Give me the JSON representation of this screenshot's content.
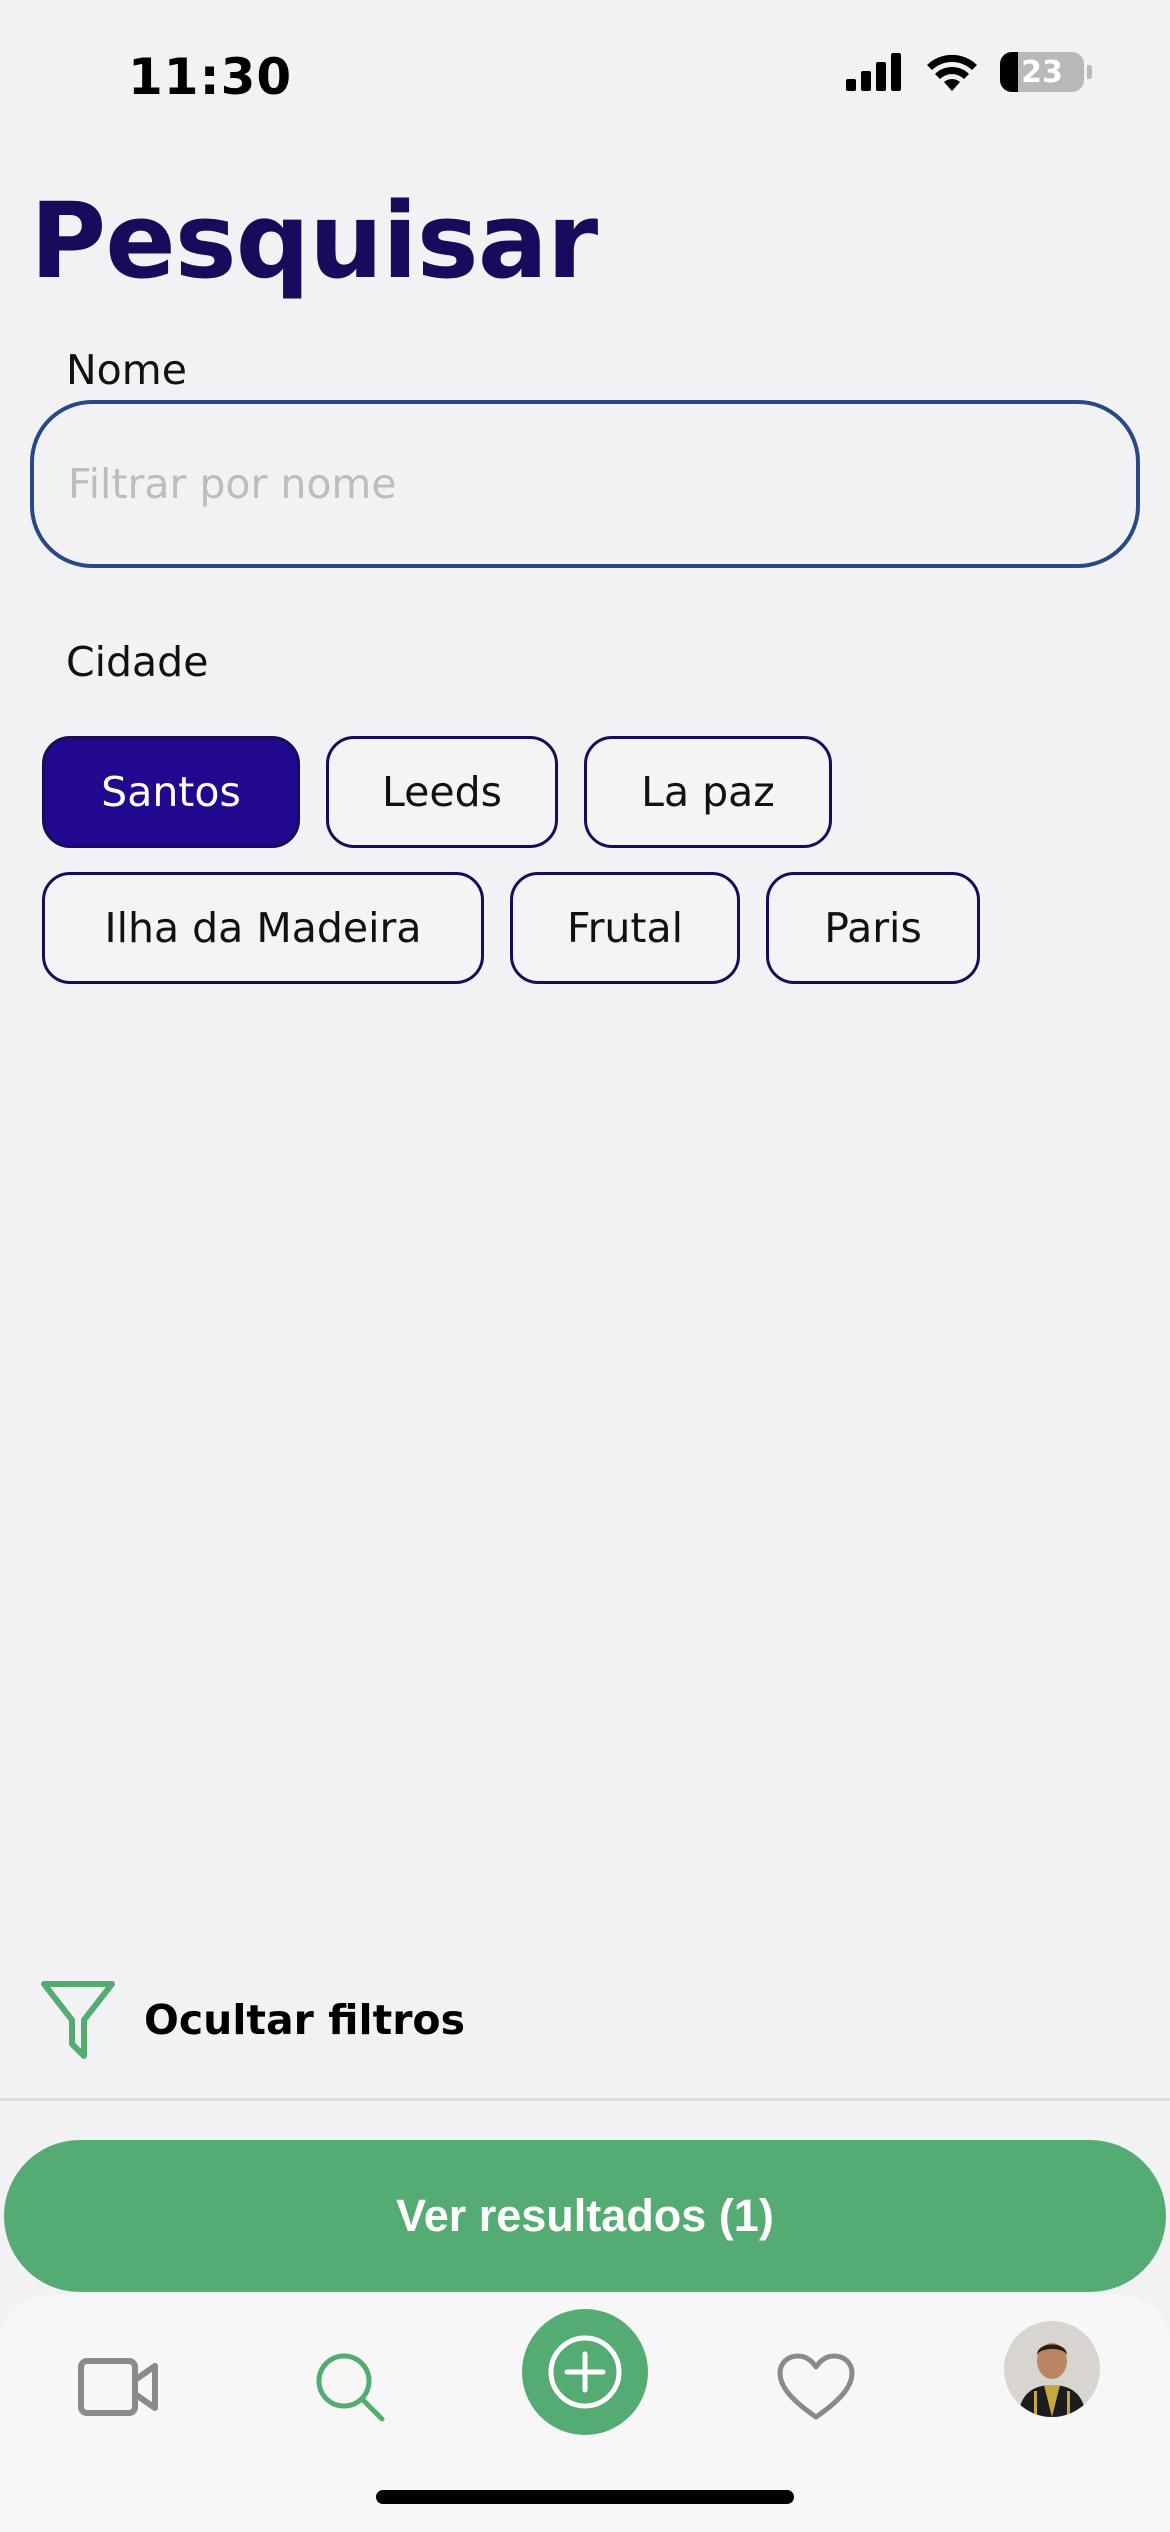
{
  "status_bar": {
    "time": "11:30",
    "battery": "23",
    "icons": [
      "signal-icon",
      "wifi-icon",
      "battery-icon"
    ]
  },
  "page": {
    "title": "Pesquisar"
  },
  "name_filter": {
    "label": "Nome",
    "placeholder": "Filtrar por nome",
    "value": ""
  },
  "city_filter": {
    "label": "Cidade",
    "chips": [
      {
        "label": "Santos",
        "selected": true
      },
      {
        "label": "Leeds",
        "selected": false
      },
      {
        "label": "La paz",
        "selected": false
      },
      {
        "label": "Ilha da Madeira",
        "selected": false
      },
      {
        "label": "Frutal",
        "selected": false
      },
      {
        "label": "Paris",
        "selected": false
      }
    ]
  },
  "filters_toggle": {
    "label": "Ocultar filtros",
    "icon": "filter-icon"
  },
  "results_button": {
    "label": "Ver resultados (1)"
  },
  "tab_bar": {
    "items": [
      {
        "name": "videos",
        "icon": "video-camera-icon"
      },
      {
        "name": "search",
        "icon": "search-icon",
        "active": true
      },
      {
        "name": "add",
        "icon": "plus-circle-icon"
      },
      {
        "name": "favorites",
        "icon": "heart-icon"
      },
      {
        "name": "profile",
        "icon": "avatar"
      }
    ]
  },
  "colors": {
    "background": "#f2f2f4",
    "title": "#1a0a5c",
    "input_border": "#274a86",
    "chip_selected": "#21088f",
    "accent_green": "#55ac72"
  }
}
